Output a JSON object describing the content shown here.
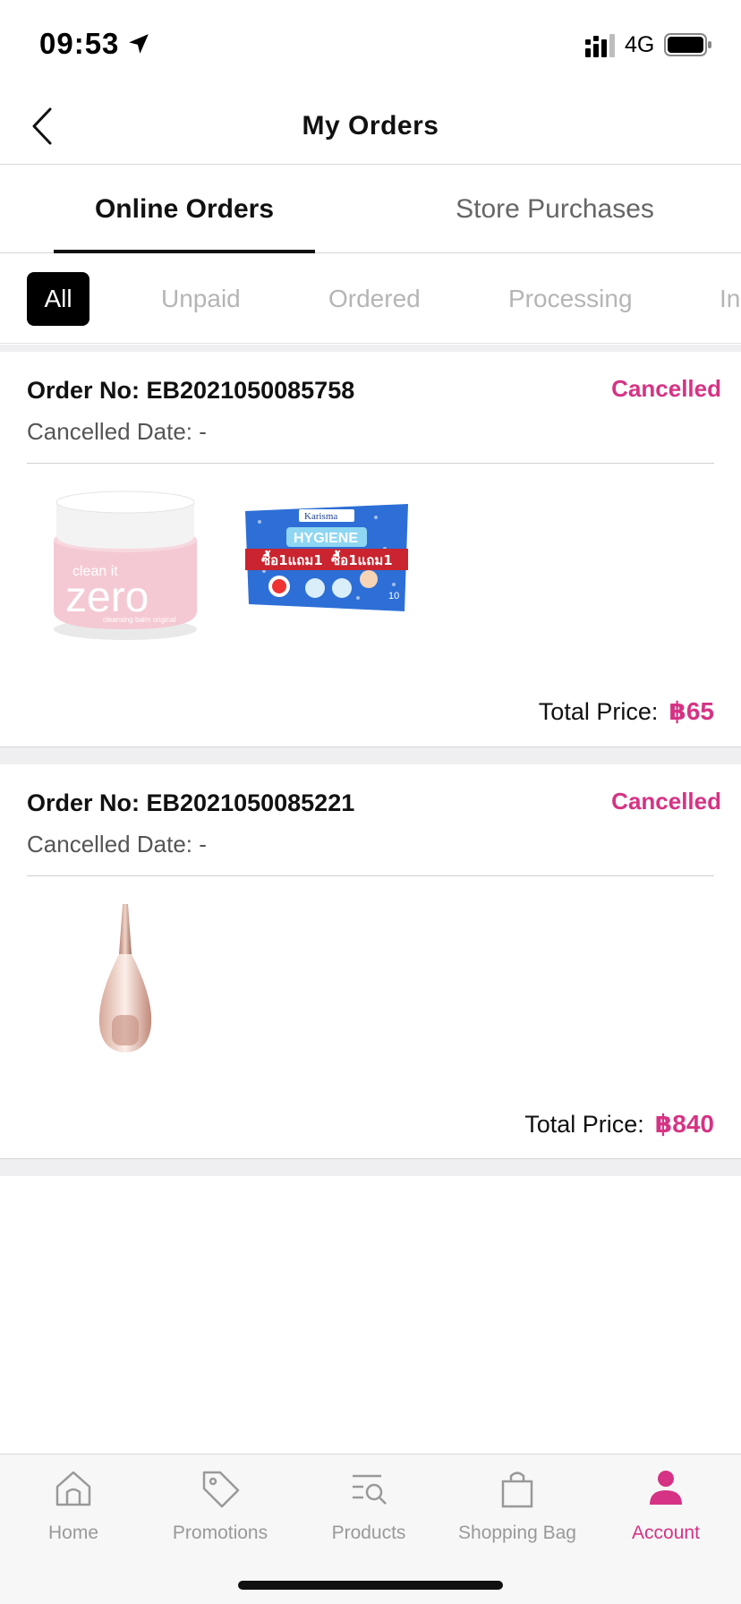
{
  "status_bar": {
    "time": "09:53",
    "network": "4G"
  },
  "header": {
    "title": "My Orders"
  },
  "tabs": [
    {
      "label": "Online Orders",
      "active": true
    },
    {
      "label": "Store Purchases",
      "active": false
    }
  ],
  "filters": [
    {
      "label": "All",
      "active": true
    },
    {
      "label": "Unpaid",
      "active": false
    },
    {
      "label": "Ordered",
      "active": false
    },
    {
      "label": "Processing",
      "active": false
    },
    {
      "label": "In",
      "active": false
    }
  ],
  "orders": [
    {
      "order_no": "Order  No:  EB2021050085758",
      "status": "Cancelled",
      "cancel_date": "Cancelled  Date:   -",
      "total_label": "Total  Price:",
      "total_value": "฿65",
      "products": [
        {
          "name": "clean it zero",
          "brand_text": "clean it",
          "main_text": "zero",
          "sub_text": "cleansing balm original"
        },
        {
          "name": "Karisma Hygiene",
          "brand_text": "Karisma",
          "main_text": "HYGIENE",
          "promo_text": "ซื้อ1แถม1",
          "count_text": "10"
        }
      ]
    },
    {
      "order_no": "Order  No:  EB2021050085221",
      "status": "Cancelled",
      "cancel_date": "Cancelled  Date:   -",
      "total_label": "Total  Price:",
      "total_value": "฿840",
      "products": [
        {
          "name": "perfume bottle"
        }
      ]
    }
  ],
  "tabbar": [
    {
      "label": "Home",
      "icon": "home-icon",
      "active": false
    },
    {
      "label": "Promotions",
      "icon": "tag-icon",
      "active": false
    },
    {
      "label": "Products",
      "icon": "search-list-icon",
      "active": false
    },
    {
      "label": "Shopping  Bag",
      "icon": "bag-icon",
      "active": false
    },
    {
      "label": "Account",
      "icon": "person-icon",
      "active": true
    }
  ],
  "colors": {
    "accent": "#d63384",
    "active_chip": "#000000",
    "inactive_text": "#b5b5b5",
    "separator": "#efeff2"
  }
}
